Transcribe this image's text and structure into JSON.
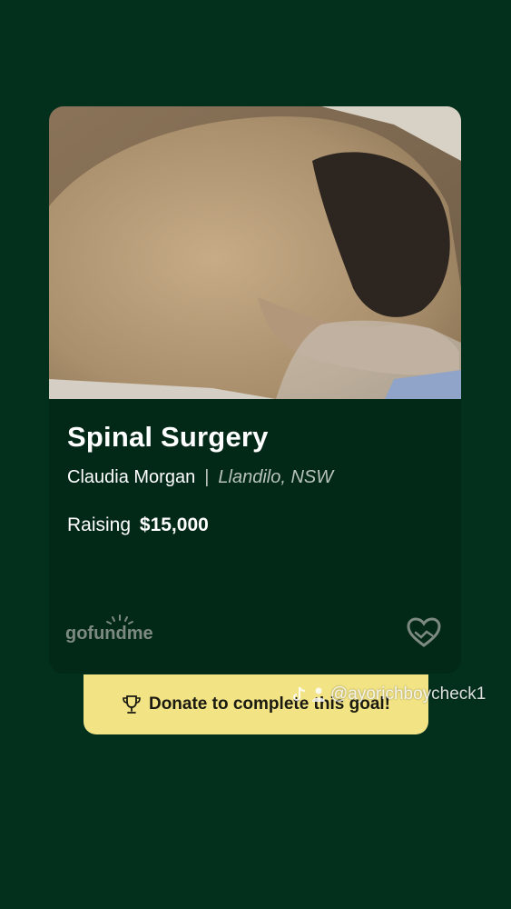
{
  "card": {
    "image_subject": "pug-photo",
    "title": "Spinal Surgery",
    "organizer": "Claudia Morgan",
    "separator": "|",
    "location": "Llandilo, NSW",
    "raising_label": "Raising",
    "raising_amount": "$15,000",
    "brand": "gofundme",
    "heart_icon": "heart-hands-icon"
  },
  "donate_banner": {
    "icon": "trophy-icon",
    "label": "Donate to complete this goal!"
  },
  "tiktok_overlay": {
    "icons": [
      "tiktok-icon",
      "profile-icon"
    ],
    "handle": "@ayorichboycheck1"
  },
  "colors": {
    "background": "#03301c",
    "card": "#022817",
    "banner": "#f2e385"
  }
}
